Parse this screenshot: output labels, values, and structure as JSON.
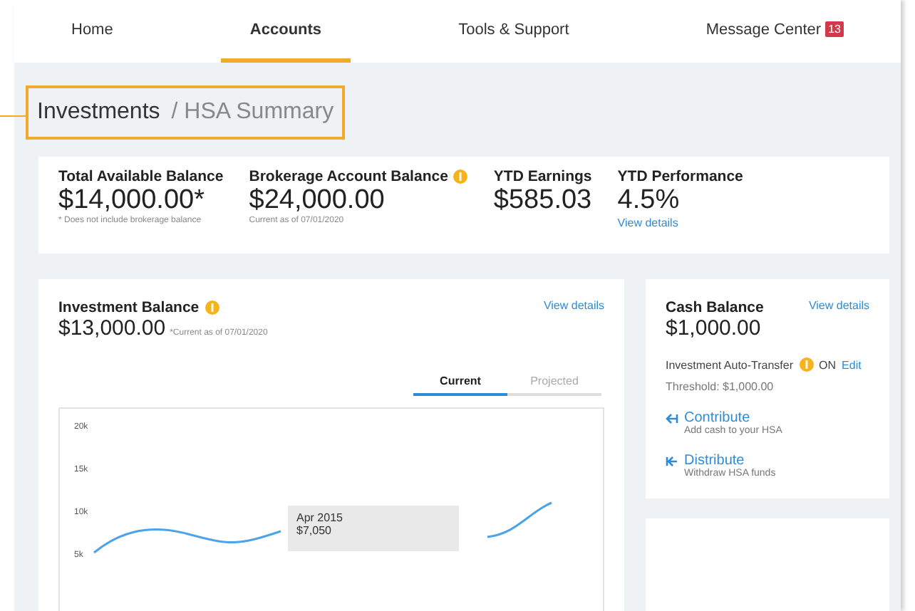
{
  "nav": [
    {
      "label": "Home",
      "selected": false
    },
    {
      "label": "Accounts",
      "selected": true
    },
    {
      "label": "Tools & Support",
      "selected": false
    },
    {
      "label": "Message Center",
      "selected": false,
      "badge": "13"
    }
  ],
  "breadcrumb": {
    "section": "Investments",
    "page": "/ HSA Summary"
  },
  "summary": [
    {
      "label": "Total Available Balance",
      "value": "$14,000.00*",
      "note": "* Does not include brokerage balance"
    },
    {
      "label": "Brokerage Account Balance",
      "help": true,
      "value": "$24,000.00",
      "note": "Current as of 07/01/2020"
    },
    {
      "label": "YTD Earnings",
      "value": "$585.03"
    },
    {
      "label": "YTD Performance",
      "value": "4.5%",
      "link": "View details"
    }
  ],
  "investment": {
    "title": "Investment Balance",
    "value": "$13,000.00",
    "note": "*Current as of 07/01/2020",
    "link": "View details",
    "tabs": [
      {
        "label": "Current",
        "selected": true
      },
      {
        "label": "Projected",
        "selected": false
      }
    ],
    "tooltip": {
      "date": "Apr 2015",
      "value": "$7,050"
    },
    "chart": {
      "y_labels": [
        "20k",
        "15k",
        "10k",
        "5k"
      ]
    }
  },
  "cash": {
    "title": "Cash Balance",
    "value": "$1,000.00",
    "link": "View details",
    "transfer_label": "Investment Auto-Transfer",
    "transfer_state": "ON",
    "edit": "Edit",
    "threshold": "Threshold: $1,000.00",
    "actions": [
      {
        "kind": "contribute",
        "label": "Contribute",
        "note": "Add cash to your HSA"
      },
      {
        "kind": "distribute",
        "label": "Distribute",
        "note": "Withdraw HSA funds"
      }
    ]
  }
}
